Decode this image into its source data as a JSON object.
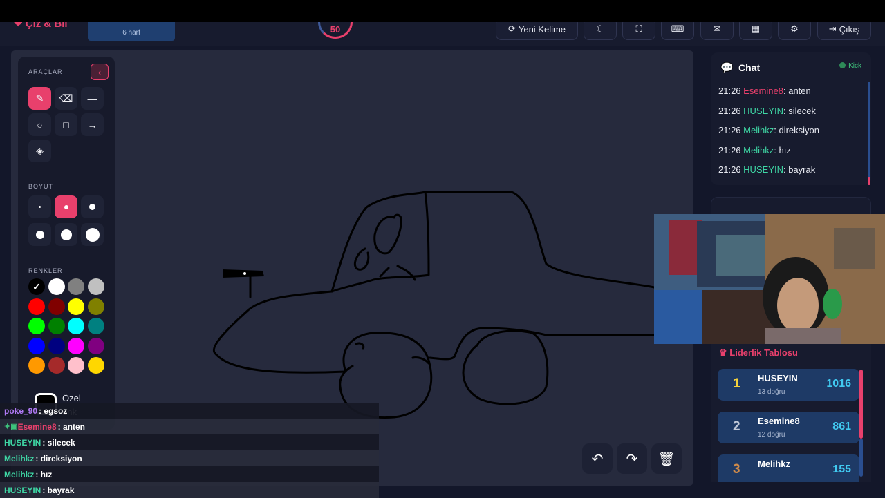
{
  "header": {
    "logo": "Çiz & Bil",
    "word_hint": "6 harf",
    "timer": "50",
    "buttons": {
      "new_word": "Yeni Kelime",
      "logout": "Çıkış"
    }
  },
  "tools": {
    "tools_title": "ARAÇLAR",
    "size_title": "BOYUT",
    "colors_title": "RENKLER",
    "custom_color_line1": "Özel",
    "custom_color_line2": "enk",
    "colors": [
      "#000000",
      "#ffffff",
      "#808080",
      "#c0c0c0",
      "#ff0000",
      "#800000",
      "#ffff00",
      "#808000",
      "#00ff00",
      "#008000",
      "#00ffff",
      "#008080",
      "#0000ff",
      "#000080",
      "#ff00ff",
      "#800080",
      "#ff9900",
      "#a52a2a",
      "#ffc0cb",
      "#ffd700"
    ]
  },
  "chat": {
    "title": "Chat",
    "kick_label": "Kick",
    "messages": [
      {
        "time": "21:26",
        "user": "Esemine8",
        "color": "#e8406c",
        "text": ": anten"
      },
      {
        "time": "21:26",
        "user": "HUSEYIN",
        "color": "#3ed6a4",
        "text": ": silecek"
      },
      {
        "time": "21:26",
        "user": "Melihkz",
        "color": "#3ed6a4",
        "text": ": direksiyon"
      },
      {
        "time": "21:26",
        "user": "Melihkz",
        "color": "#3ed6a4",
        "text": ": hız"
      },
      {
        "time": "21:26",
        "user": "HUSEYIN",
        "color": "#3ed6a4",
        "text": ": bayrak"
      }
    ]
  },
  "leaderboard": {
    "title": "Liderlik Tablosu",
    "entries": [
      {
        "rank": "1",
        "name": "HUSEYIN",
        "correct": "13 doğru",
        "score": "1016",
        "rank_color": "#f5d23c"
      },
      {
        "rank": "2",
        "name": "Esemine8",
        "correct": "12 doğru",
        "score": "861",
        "rank_color": "#c0c8d8"
      },
      {
        "rank": "3",
        "name": "Melihkz",
        "correct": "",
        "score": "155",
        "rank_color": "#d08b4a"
      }
    ]
  },
  "overlay_chat": [
    {
      "user": "poke_90",
      "color": "#b07af5",
      "text": " : egsoz",
      "badge": false
    },
    {
      "user": "Esemine8",
      "color": "#e8406c",
      "text": " : anten",
      "badge": true
    },
    {
      "user": "HUSEYIN",
      "color": "#3ed6a4",
      "text": " : silecek",
      "badge": false
    },
    {
      "user": "Melihkz",
      "color": "#3ed6a4",
      "text": " : direksiyon",
      "badge": false
    },
    {
      "user": "Melihkz",
      "color": "#3ed6a4",
      "text": " : hız",
      "badge": false
    },
    {
      "user": "HUSEYIN",
      "color": "#3ed6a4",
      "text": " : bayrak",
      "badge": false
    }
  ],
  "icons": {
    "brush": "brush-icon",
    "eraser": "eraser-icon",
    "line": "line-icon",
    "circle": "circle-icon",
    "square": "square-icon",
    "arrow": "arrow-icon",
    "fill": "fill-bucket-icon",
    "undo": "undo-icon",
    "redo": "redo-icon",
    "trash": "trash-icon"
  }
}
